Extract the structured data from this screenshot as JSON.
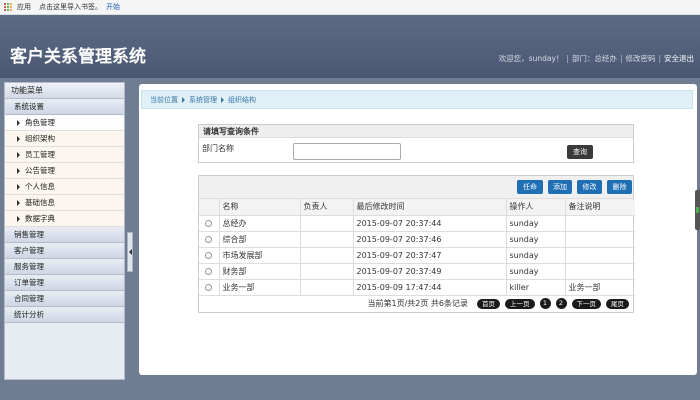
{
  "bookmarks": {
    "apps_label": "应用",
    "hint": "点击这里导入书签。",
    "start_link": "开始"
  },
  "header": {
    "title": "客户关系管理系统",
    "welcome": "欢迎您，sunday！",
    "department": "部门：总经办",
    "change_password": "修改密码",
    "logout": "安全退出"
  },
  "sidebar": {
    "title": "功能菜单",
    "system_settings": "系统设置",
    "items": [
      {
        "label": "角色管理"
      },
      {
        "label": "组织架构"
      },
      {
        "label": "员工管理"
      },
      {
        "label": "公告管理"
      },
      {
        "label": "个人信息"
      },
      {
        "label": "基础信息"
      },
      {
        "label": "数据字典"
      }
    ],
    "groups": [
      {
        "label": "销售管理"
      },
      {
        "label": "客户管理"
      },
      {
        "label": "服务管理"
      },
      {
        "label": "订单管理"
      },
      {
        "label": "合同管理"
      },
      {
        "label": "统计分析"
      }
    ]
  },
  "breadcrumb": {
    "current": "当前位置",
    "section": "系统管理",
    "page": "组织结构"
  },
  "query": {
    "title": "请填写查询条件",
    "dept_label": "部门名称",
    "dept_value": "",
    "search_button": "查询"
  },
  "toolbar": {
    "appoint": "任命",
    "add": "添加",
    "edit": "修改",
    "delete": "删除"
  },
  "table": {
    "headers": [
      "名称",
      "负责人",
      "最后修改时间",
      "操作人",
      "备注说明"
    ],
    "rows": [
      {
        "name": "总经办",
        "manager": "",
        "modified": "2015-09-07 20:37:44",
        "operator": "sunday",
        "remark": ""
      },
      {
        "name": "综合部",
        "manager": "",
        "modified": "2015-09-07 20:37:46",
        "operator": "sunday",
        "remark": ""
      },
      {
        "name": "市场发展部",
        "manager": "",
        "modified": "2015-09-07 20:37:47",
        "operator": "sunday",
        "remark": ""
      },
      {
        "name": "财务部",
        "manager": "",
        "modified": "2015-09-07 20:37:49",
        "operator": "sunday",
        "remark": ""
      },
      {
        "name": "业务一部",
        "manager": "",
        "modified": "2015-09-09 17:47:44",
        "operator": "killer",
        "remark": "业务一部"
      }
    ]
  },
  "pager": {
    "summary": "当前第1页/共2页  共6条记录",
    "first": "首页",
    "prev": "上一页",
    "page1": "1",
    "page2": "2",
    "next": "下一页",
    "last": "尾页"
  },
  "colors": {
    "header_bg": "#53627c",
    "toolbar_button": "#1f6fb5",
    "breadcrumb_bg": "#dff0f7"
  }
}
